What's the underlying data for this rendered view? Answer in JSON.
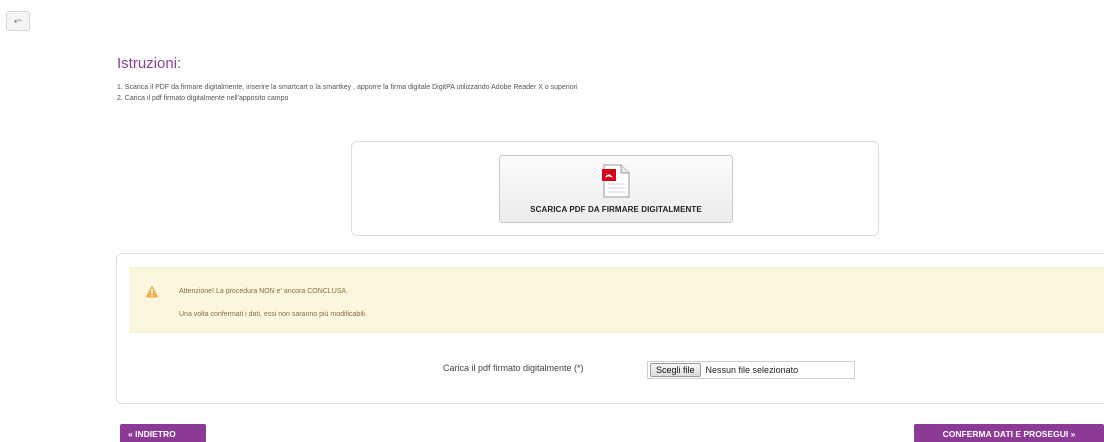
{
  "nav": {
    "back_icon": "⬿",
    "back_label": "« INDIETRO",
    "confirm_label": "CONFERMA DATI E PROSEGUI »"
  },
  "instructions": {
    "title": "Istruzioni:",
    "steps": [
      "1. Scarica il PDF da firmare digitalmente, inserire la smartcart o la smartkey , apporre la firma digitale DigitPA utilizzando Adobe Reader X o superiori",
      "2. Carica il pdf firmato digitalmente nell'apposito campo"
    ]
  },
  "download": {
    "label": "SCARICA PDF DA FIRMARE DIGITALMENTE",
    "icon": "pdf-file-icon"
  },
  "alert": {
    "icon": "warning-icon",
    "line1": "Attenzione! La procedura NON e' ancora CONCLUSA.",
    "line2": "Una volta confermati i dati, essi non saranno più modificabili."
  },
  "upload": {
    "label": "Carica il pdf firmato digitalmente (*)",
    "choose_label": "Scegli file",
    "no_file_label": "Nessun file selezionato"
  },
  "colors": {
    "accent": "#8b3a96",
    "alert_bg": "#fcf6e1",
    "alert_text": "#8a6d3b",
    "warning": "#f0ad4e",
    "pdf_red": "#d0021b"
  }
}
